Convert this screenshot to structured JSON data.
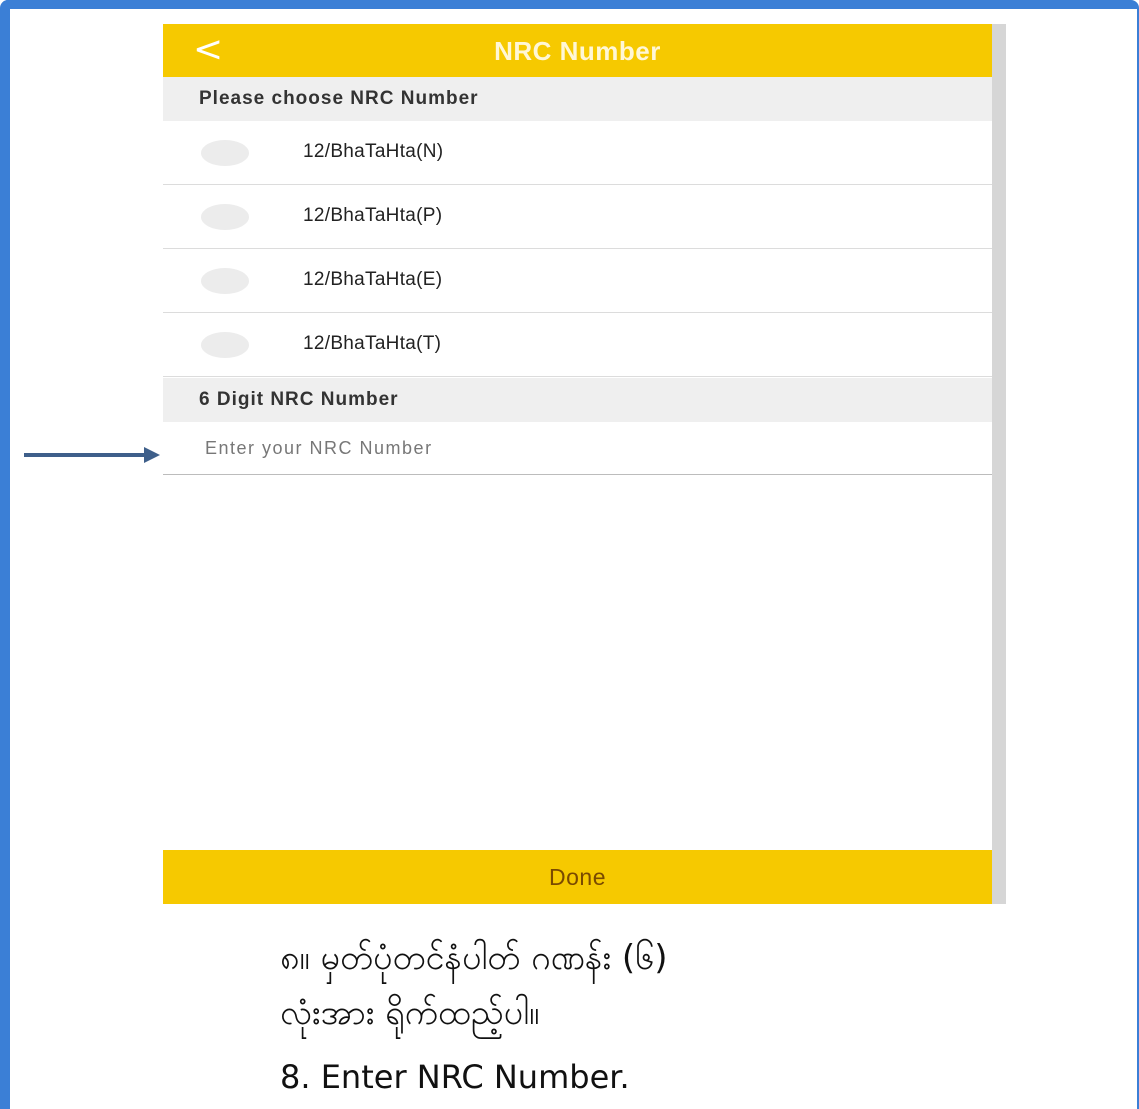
{
  "header": {
    "back_icon": "chevron-left-icon",
    "back_glyph": "<",
    "title": "NRC Number"
  },
  "section_choose": {
    "label": "Please choose NRC Number"
  },
  "options": [
    {
      "label": "12/BhaTaHta(N)"
    },
    {
      "label": "12/BhaTaHta(P)"
    },
    {
      "label": "12/BhaTaHta(E)"
    },
    {
      "label": "12/BhaTaHta(T)"
    }
  ],
  "section_digits": {
    "label": "6 Digit NRC Number"
  },
  "nrc_input": {
    "placeholder": "Enter your NRC Number",
    "value": ""
  },
  "done_button": {
    "label": "Done"
  },
  "caption": {
    "myanmar_line1": "၈။ မှတ်ပုံတင်နံပါတ် ဂဏန်း (၆)",
    "myanmar_line2": "လုံးအား ရိုက်ထည့်ပါ။",
    "english": "8. Enter NRC Number."
  },
  "colors": {
    "accent": "#f6c900",
    "frame": "#3b7fd6",
    "arrow": "#3e5f8a"
  }
}
